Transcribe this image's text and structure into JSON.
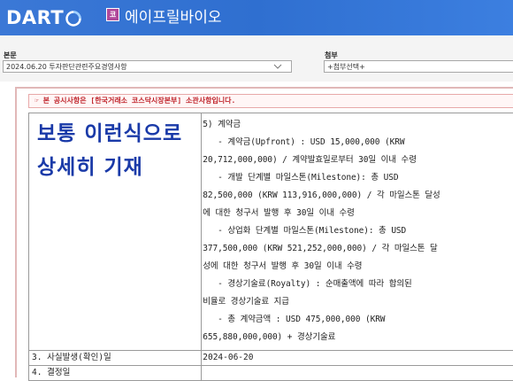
{
  "header": {
    "logo_text": "DART",
    "company_badge": "코",
    "company_name": "에이프릴바이오",
    "colors": {
      "bar": "#2f6fd0",
      "badge": "#b0489a"
    }
  },
  "toolbar": {
    "main_label": "본문",
    "main_value": "2024.06.20  투자판단관련주요경영사항",
    "attach_label": "첨부",
    "attach_value": "+첨부선택+"
  },
  "document": {
    "notice": "☞ 본 공시사항은 [한국거래소 코스닥시장본부] 소관사항입니다.",
    "overlay_line1": "보통 이런식으로",
    "overlay_line2": "상세히 기재",
    "content_lines": [
      "5) 계약금",
      "   - 계약금(Upfront) : USD 15,000,000 (KRW",
      "20,712,000,000) / 계약발효일로부터 30일 이내 수령",
      "   - 개발 단계별 마일스톤(Milestone): 총 USD",
      "82,500,000 (KRW 113,916,000,000) / 각 마일스톤 달성",
      "에 대한 청구서 발행 후 30일 이내 수령",
      "   - 상업화 단계별 마일스톤(Milestone): 총 USD",
      "377,500,000 (KRW 521,252,000,000) / 각 마일스톤 달",
      "성에 대한 청구서 발행 후 30일 이내 수령",
      "   - 경상기술료(Royalty) : 순매출액에 따라 합의된",
      "비율로 경상기술료 지급",
      "   - 총 계약금액 : USD 475,000,000 (KRW",
      "655,880,000,000) + 경상기술료"
    ],
    "row3_label": "3. 사실발생(확인)일",
    "row3_value": "2024-06-20",
    "row4_label": "4. 결정일"
  }
}
